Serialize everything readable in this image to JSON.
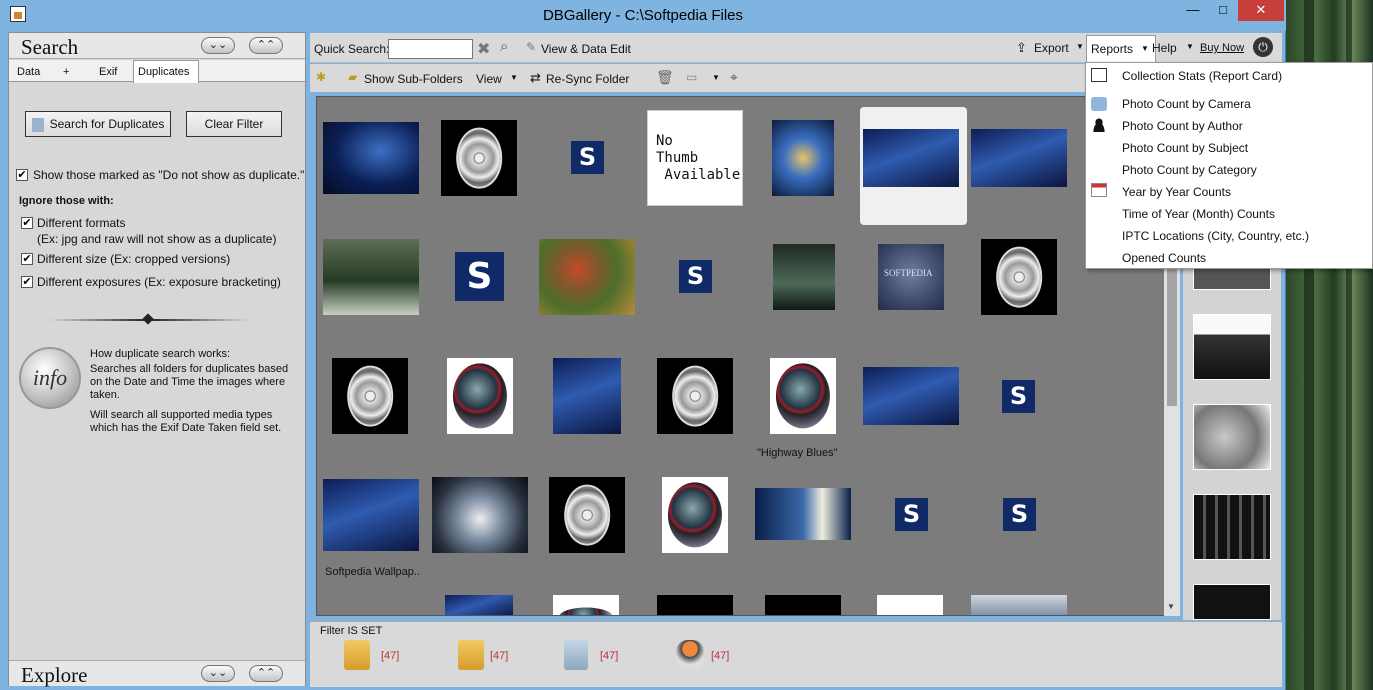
{
  "window": {
    "title": "DBGallery - C:\\Softpedia Files",
    "minimize": "—",
    "maximize": "□",
    "close": "✕"
  },
  "left_panel": {
    "search_title": "Search",
    "explore_title": "Explore",
    "tabs": [
      "Data",
      "+",
      "Exif",
      "Duplicates"
    ],
    "active_tab": "Duplicates",
    "search_button": "Search for Duplicates",
    "clear_button": "Clear Filter",
    "show_marked": "Show those marked as \"Do not show as duplicate.\"",
    "ignore_heading": "Ignore those with:",
    "options": [
      {
        "label": "Different formats",
        "sub": "(Ex: jpg and raw will not show as a duplicate)"
      },
      {
        "label": "Different size (Ex: cropped versions)",
        "sub": ""
      },
      {
        "label": "Different exposures (Ex: exposure bracketing)",
        "sub": ""
      }
    ],
    "info_icon": "info",
    "info_lines": [
      "How duplicate search works:",
      "Searches all folders for duplicates based",
      "on the Date and Time the images where",
      "taken.",
      "Will search all supported media types",
      "which has the Exif Date Taken field set."
    ]
  },
  "toolbar": {
    "quick_search_label": "Quick Search:",
    "quick_search_value": "",
    "view_data_edit": "View & Data Edit",
    "export": "Export",
    "reports": "Reports",
    "help": "Help",
    "buy_now": "Buy Now",
    "show_subfolders": "Show Sub-Folders",
    "view": "View",
    "resync": "Re-Sync Folder"
  },
  "reports_menu": [
    {
      "label": "Collection Stats (Report Card)",
      "icon": "report-card-icon"
    },
    {
      "label": "Photo Count by Camera",
      "icon": "camera-icon"
    },
    {
      "label": "Photo Count by Author",
      "icon": "person-icon"
    },
    {
      "label": "Photo Count by Subject",
      "icon": ""
    },
    {
      "label": "Photo Count by Category",
      "icon": ""
    },
    {
      "label": "Year by Year Counts",
      "icon": "calendar-icon"
    },
    {
      "label": "Time of Year (Month) Counts",
      "icon": ""
    },
    {
      "label": "IPTC Locations (City, Country, etc.)",
      "icon": ""
    },
    {
      "label": "Opened Counts",
      "icon": ""
    }
  ],
  "thumbnails": {
    "s_letter": "S",
    "no_thumb": "No\nThumb\n Available",
    "caption_highway": "\"Highway Blues\"",
    "caption_wallpaper": "Softpedia Wallpap..",
    "watermark": "SOFTPEDIA"
  },
  "filter_bar": {
    "label": "Filter IS SET",
    "counts": [
      "[47]",
      "[47]",
      "[47]",
      "[47]"
    ]
  }
}
